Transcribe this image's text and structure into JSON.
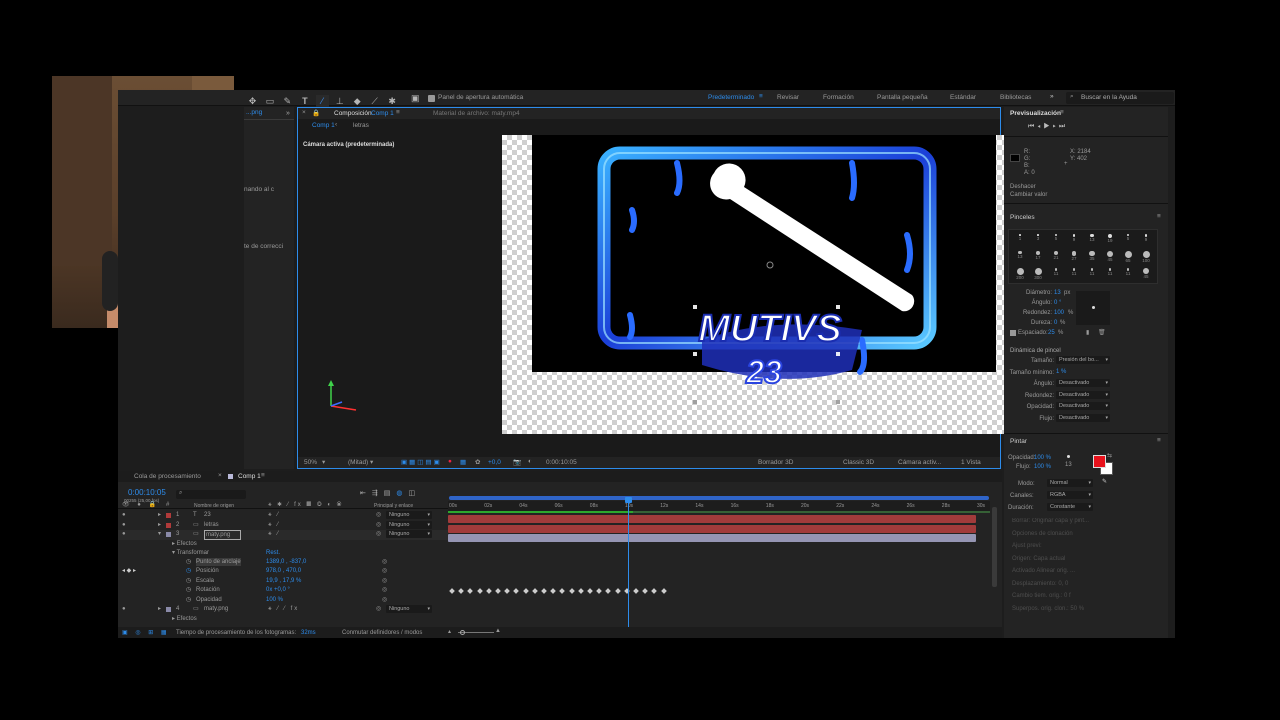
{
  "toolbar": {
    "auto_open_panel": "Panel de apertura automática",
    "workspaces": [
      "Predeterminado",
      "Revisar",
      "Formación",
      "Pantalla pequeña",
      "Estándar",
      "Bibliotecas"
    ],
    "active_workspace_index": 0,
    "search_placeholder": "Buscar en la Ayuda"
  },
  "left_panel": {
    "tab": "...png",
    "label1": "nando al c",
    "label2": "te de correcci"
  },
  "comp_panel": {
    "tab_label": "Composición",
    "tab_comp": "Comp 1",
    "footage_tab": "Material de archivo: maty.mp4",
    "breadcrumb": [
      "Comp 1",
      "letras"
    ],
    "camera_label": "Cámara activa (predeterminada)",
    "footer": {
      "zoom": "50%",
      "resolution": "(Mitad)",
      "timecode": "0:00:10:05",
      "exposure": "+0,0",
      "renderer_3d": "Borrador 3D",
      "renderer": "Classic 3D",
      "camera": "Cámara activ...",
      "views": "1 Vista"
    },
    "logo_text": "MUTIVS",
    "logo_num": "23"
  },
  "preview": {
    "title": "Previsualización",
    "info": {
      "r": "R:",
      "g": "G:",
      "b": "B:",
      "a": "A: 0",
      "x": "X: 2184",
      "y": "Y: 402"
    },
    "undo": "Deshacer",
    "change_value": "Cambiar valor"
  },
  "brushes": {
    "title": "Pinceles",
    "sizes": [
      "1",
      "3",
      "5",
      "9",
      "13",
      "19",
      "5",
      "9",
      "13",
      "17",
      "21",
      "27",
      "35",
      "45",
      "65",
      "100",
      "200",
      "300",
      "11",
      "11",
      "11",
      "11",
      "11",
      "45"
    ],
    "diameter_label": "Diámetro:",
    "diameter_value": "13",
    "diameter_unit": "px",
    "angle_label": "Ángulo:",
    "angle_value": "0 °",
    "roundness_label": "Redondez:",
    "roundness_value": "100",
    "hardness_label": "Dureza:",
    "hardness_value": "0",
    "spacing_label": "Espaciado:",
    "spacing_value": "25",
    "pct": "%",
    "dynamics_title": "Dinámica de pincel",
    "dyn": [
      {
        "label": "Tamaño:",
        "value": "Presión del bo..."
      },
      {
        "label": "Tamaño mínimo:",
        "value": "1 %"
      },
      {
        "label": "Ángulo:",
        "value": "Desactivado"
      },
      {
        "label": "Redondez:",
        "value": "Desactivado"
      },
      {
        "label": "Opacidad:",
        "value": "Desactivado"
      },
      {
        "label": "Flujo:",
        "value": "Desactivado"
      }
    ]
  },
  "paint": {
    "title": "Pintar",
    "opacity_label": "Opacidad:",
    "opacity_value": "100 %",
    "flow_label": "Flujo:",
    "flow_value": "100 %",
    "size_num": "13",
    "mode_label": "Modo:",
    "mode_value": "Normal",
    "channels_label": "Canales:",
    "channels_value": "RGBA",
    "duration_label": "Duración:",
    "duration_value": "Constante",
    "fg_color": "#e8111b",
    "bg_color": "#ffffff",
    "disabled_rows": [
      "Borrar:  Originar capa y pint...",
      "Opciones de clonación",
      "Ajust previ:",
      "Origen:  Capa actual",
      "Activado    Alinear orig. ...",
      "Desplazamiento:  0, 0",
      "Cambio tiem. orig.:  0 f",
      "Superpos. orig. clon.:   50 %"
    ]
  },
  "timeline": {
    "render_queue_tab": "Cola de procesamiento",
    "comp_tab": "Comp 1",
    "timecode": "0:00:10:05",
    "frames": "00255 (25,00 fps)",
    "columns": {
      "source": "Nombre de origen",
      "parent": "Principal y enlace"
    },
    "layers": [
      {
        "num": "1",
        "type": "T",
        "name": "23",
        "parent": "Ninguno",
        "color": "#b03a3a"
      },
      {
        "num": "2",
        "type": "▭",
        "name": "letras",
        "parent": "Ninguno",
        "color": "#b03a3a"
      },
      {
        "num": "3",
        "type": "▭",
        "name": "maty.png",
        "parent": "Ninguno",
        "color": "#8a8aa8"
      },
      {
        "num": "4",
        "type": "▭",
        "name": "maty.png",
        "parent": "Ninguno",
        "color": "#8a8aa8"
      }
    ],
    "effects": "Efectos",
    "transform": "Transformar",
    "reset": "Rest.",
    "props": [
      {
        "name": "Punto de anclaje",
        "value": "1389,0 , -837,0"
      },
      {
        "name": "Posición",
        "value": "978,0 , 470,0"
      },
      {
        "name": "Escala",
        "value": "19,9 , 17,9 %"
      },
      {
        "name": "Rotación",
        "value": "0x +0,0 °"
      },
      {
        "name": "Opacidad",
        "value": "100 %"
      }
    ],
    "ruler": [
      "00s",
      "02s",
      "04s",
      "06s",
      "08s",
      "10s",
      "12s",
      "14s",
      "16s",
      "18s",
      "20s",
      "22s",
      "24s",
      "26s",
      "28s",
      "30s"
    ],
    "playhead_fraction": 0.34,
    "footer_label": "Tiempo de procesamiento de los fotogramas:",
    "footer_value": "32ms",
    "footer_toggle": "Conmutar definidores / modos"
  }
}
